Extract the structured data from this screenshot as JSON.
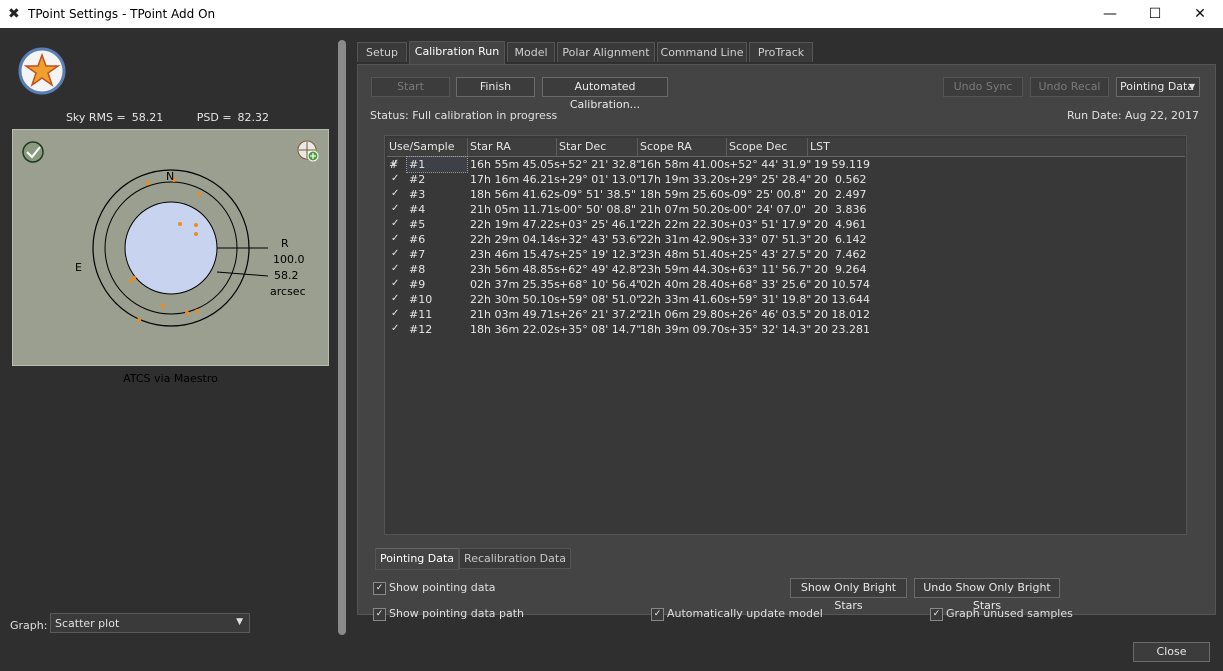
{
  "window": {
    "title": "TPoint Settings - TPoint Add On",
    "minimize_glyph": "—",
    "maximize_glyph": "☐",
    "close_glyph": "✕",
    "app_icon_glyph": "✖"
  },
  "left": {
    "sky_rms_label": "Sky RMS =",
    "sky_rms_value": "58.21",
    "psd_label": "PSD =",
    "psd_value": "82.32",
    "graph": {
      "north_label": "N",
      "east_label": "E",
      "r_label": "R",
      "outer_value": "100.0",
      "inner_value": "58.2",
      "unit": "arcsec",
      "caption": "ATCS via Maestro",
      "check_glyph": "✓"
    },
    "graph_select_label": "Graph:",
    "graph_select_value": "Scatter plot",
    "dropdown_glyph": "▼"
  },
  "tabs": [
    "Setup",
    "Calibration Run",
    "Model",
    "Polar Alignment",
    "Command Line",
    "ProTrack"
  ],
  "active_tab": "Calibration Run",
  "toolbar": {
    "start_label": "Start",
    "finish_label": "Finish",
    "automated_label": "Automated Calibration...",
    "undo_sync_label": "Undo Sync",
    "undo_recal_label": "Undo Recal",
    "pointing_data_label": "Pointing Data"
  },
  "status_text": "Status: Full calibration in progress",
  "run_date": "Run Date: Aug 22, 2017",
  "table": {
    "columns": [
      "Use/Sample #",
      "Star RA",
      "Star Dec",
      "Scope RA",
      "Scope Dec",
      "LST"
    ],
    "check_glyph": "✓",
    "rows": [
      {
        "sample": "#1",
        "star_ra": "16h 55m 45.05s",
        "star_dec": "+52° 21' 32.8\"",
        "scope_ra": "16h 58m 41.00s",
        "scope_dec": "+52° 44' 31.9\"",
        "lst": "19 59.119"
      },
      {
        "sample": "#2",
        "star_ra": "17h 16m 46.21s",
        "star_dec": "+29° 01' 13.0\"",
        "scope_ra": "17h 19m 33.20s",
        "scope_dec": "+29° 25' 28.4\"",
        "lst": "20  0.562"
      },
      {
        "sample": "#3",
        "star_ra": "18h 56m 41.62s",
        "star_dec": "-09° 51' 38.5\"",
        "scope_ra": "18h 59m 25.60s",
        "scope_dec": "-09° 25' 00.8\"",
        "lst": "20  2.497"
      },
      {
        "sample": "#4",
        "star_ra": "21h 05m 11.71s",
        "star_dec": "-00° 50' 08.8\"",
        "scope_ra": "21h 07m 50.20s",
        "scope_dec": "-00° 24' 07.0\"",
        "lst": "20  3.836"
      },
      {
        "sample": "#5",
        "star_ra": "22h 19m 47.22s",
        "star_dec": "+03° 25' 46.1\"",
        "scope_ra": "22h 22m 22.30s",
        "scope_dec": "+03° 51' 17.9\"",
        "lst": "20  4.961"
      },
      {
        "sample": "#6",
        "star_ra": "22h 29m 04.14s",
        "star_dec": "+32° 43' 53.6\"",
        "scope_ra": "22h 31m 42.90s",
        "scope_dec": "+33° 07' 51.3\"",
        "lst": "20  6.142"
      },
      {
        "sample": "#7",
        "star_ra": "23h 46m 15.47s",
        "star_dec": "+25° 19' 12.3\"",
        "scope_ra": "23h 48m 51.40s",
        "scope_dec": "+25° 43' 27.5\"",
        "lst": "20  7.462"
      },
      {
        "sample": "#8",
        "star_ra": "23h 56m 48.85s",
        "star_dec": "+62° 49' 42.8\"",
        "scope_ra": "23h 59m 44.30s",
        "scope_dec": "+63° 11' 56.7\"",
        "lst": "20  9.264"
      },
      {
        "sample": "#9",
        "star_ra": "02h 37m 25.35s",
        "star_dec": "+68° 10' 56.4\"",
        "scope_ra": "02h 40m 28.40s",
        "scope_dec": "+68° 33' 25.6\"",
        "lst": "20 10.574"
      },
      {
        "sample": "#10",
        "star_ra": "22h 30m 50.10s",
        "star_dec": "+59° 08' 51.0\"",
        "scope_ra": "22h 33m 41.60s",
        "scope_dec": "+59° 31' 19.8\"",
        "lst": "20 13.644"
      },
      {
        "sample": "#11",
        "star_ra": "21h 03m 49.71s",
        "star_dec": "+26° 21' 37.2\"",
        "scope_ra": "21h 06m 29.80s",
        "scope_dec": "+26° 46' 03.5\"",
        "lst": "20 18.012"
      },
      {
        "sample": "#12",
        "star_ra": "18h 36m 22.02s",
        "star_dec": "+35° 08' 14.7\"",
        "scope_ra": "18h 39m 09.70s",
        "scope_dec": "+35° 32' 14.3\"",
        "lst": "20 23.281"
      }
    ]
  },
  "subtabs": [
    "Pointing Data",
    "Recalibration Data"
  ],
  "options": {
    "show_pointing_data": "Show pointing data",
    "show_pointing_data_path": "Show pointing data path",
    "auto_update_model": "Automatically update model",
    "graph_unused_samples": "Graph unused samples",
    "show_bright_stars": "Show Only Bright Stars",
    "undo_bright_stars": "Undo Show Only Bright Stars"
  },
  "close_label": "Close"
}
